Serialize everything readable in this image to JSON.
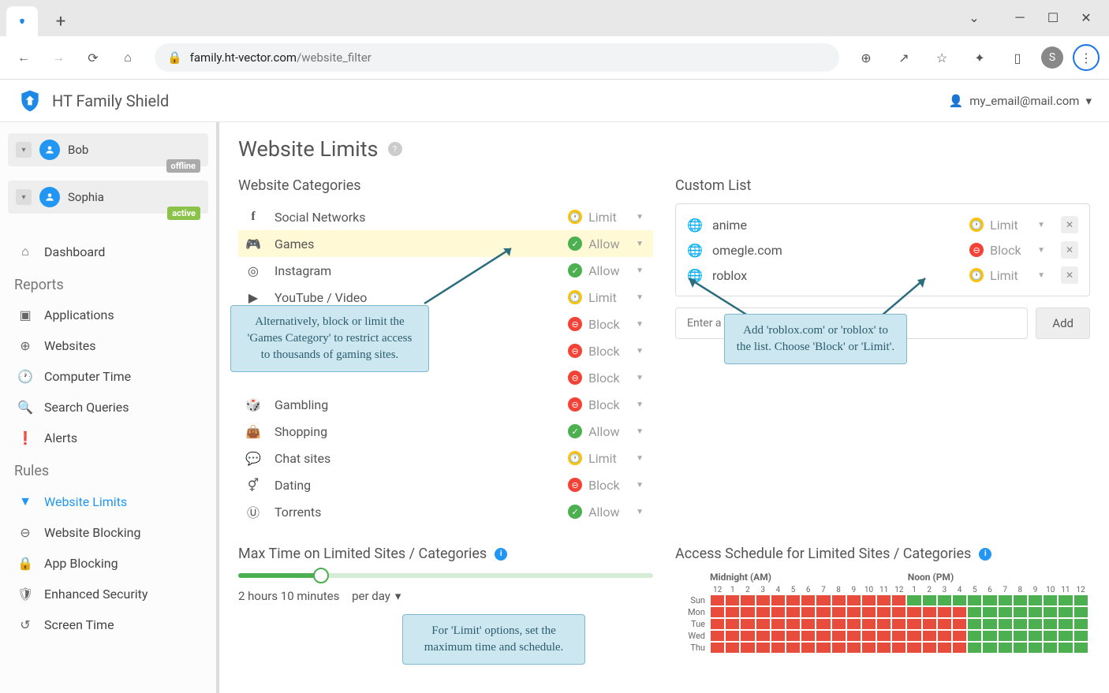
{
  "browser": {
    "url_host": "family.ht-vector.com",
    "url_path": "/website_filter",
    "avatar": "S"
  },
  "app": {
    "title": "HT Family Shield",
    "user_email": "my_email@mail.com"
  },
  "profiles": [
    {
      "name": "Bob",
      "status": "offline"
    },
    {
      "name": "Sophia",
      "status": "active"
    }
  ],
  "nav": {
    "dashboard": "Dashboard",
    "reports_header": "Reports",
    "applications": "Applications",
    "websites": "Websites",
    "computer_time": "Computer Time",
    "search_queries": "Search Queries",
    "alerts": "Alerts",
    "rules_header": "Rules",
    "website_limits": "Website Limits",
    "website_blocking": "Website Blocking",
    "app_blocking": "App Blocking",
    "enhanced_security": "Enhanced Security",
    "screen_time": "Screen Time"
  },
  "page": {
    "title": "Website Limits",
    "categories_title": "Website Categories",
    "custom_title": "Custom List",
    "add_placeholder": "Enter a website address (i.e. facebook.com)",
    "add_button": "Add",
    "max_time_title": "Max Time on Limited Sites / Categories",
    "max_time_value": "2 hours 10 minutes",
    "max_time_unit": "per day",
    "schedule_title": "Access Schedule for Limited Sites / Categories",
    "schedule_midnight": "Midnight (AM)",
    "schedule_noon": "Noon (PM)"
  },
  "categories": [
    {
      "name": "Social Networks",
      "status": "Limit",
      "dot": "limit",
      "icon": "facebook"
    },
    {
      "name": "Games",
      "status": "Allow",
      "dot": "allow",
      "icon": "gamepad",
      "highlighted": true
    },
    {
      "name": "Instagram",
      "status": "Allow",
      "dot": "allow",
      "icon": "instagram"
    },
    {
      "name": "YouTube / Video",
      "status": "Limit",
      "dot": "limit",
      "icon": "youtube"
    },
    {
      "name": "",
      "status": "Block",
      "dot": "block",
      "icon": ""
    },
    {
      "name": "",
      "status": "Block",
      "dot": "block",
      "icon": ""
    },
    {
      "name": "",
      "status": "Block",
      "dot": "block",
      "icon": ""
    },
    {
      "name": "Gambling",
      "status": "Block",
      "dot": "block",
      "icon": "dice"
    },
    {
      "name": "Shopping",
      "status": "Allow",
      "dot": "allow",
      "icon": "bag"
    },
    {
      "name": "Chat sites",
      "status": "Limit",
      "dot": "limit",
      "icon": "chat"
    },
    {
      "name": "Dating",
      "status": "Block",
      "dot": "block",
      "icon": "gender"
    },
    {
      "name": "Torrents",
      "status": "Allow",
      "dot": "allow",
      "icon": "torrent"
    }
  ],
  "custom_list": [
    {
      "name": "anime",
      "status": "Limit",
      "dot": "limit"
    },
    {
      "name": "omegle.com",
      "status": "Block",
      "dot": "block"
    },
    {
      "name": "roblox",
      "status": "Limit",
      "dot": "limit"
    }
  ],
  "schedule": {
    "hours": [
      "12",
      "1",
      "2",
      "3",
      "4",
      "5",
      "6",
      "7",
      "8",
      "9",
      "10",
      "11",
      "12",
      "1",
      "2",
      "3",
      "4",
      "5",
      "6",
      "7",
      "8",
      "9",
      "10",
      "11",
      "12"
    ],
    "days": [
      "Sun",
      "Mon",
      "Tue",
      "Wed",
      "Thu"
    ],
    "rows": [
      "bbbbbbbbbbbbbaaaaaaaaaaaa",
      "bbbbbbbbbbbbbbbbbaaaaaaaa",
      "bbbbbbbbbbbbbbbbbaaaaaaaa",
      "bbbbbbbbbbbbbbbbbaaaaaaaa",
      "bbbbbbbbbbbbbbbbbaaaaaaaa"
    ]
  },
  "callouts": {
    "c1": "Alternatively, block or limit the 'Games Category' to restrict access to thousands of gaming sites.",
    "c2": "Add 'roblox.com' or 'roblox' to the list. Choose 'Block' or 'Limit'.",
    "c3": "For 'Limit' options, set the maximum time and schedule."
  }
}
